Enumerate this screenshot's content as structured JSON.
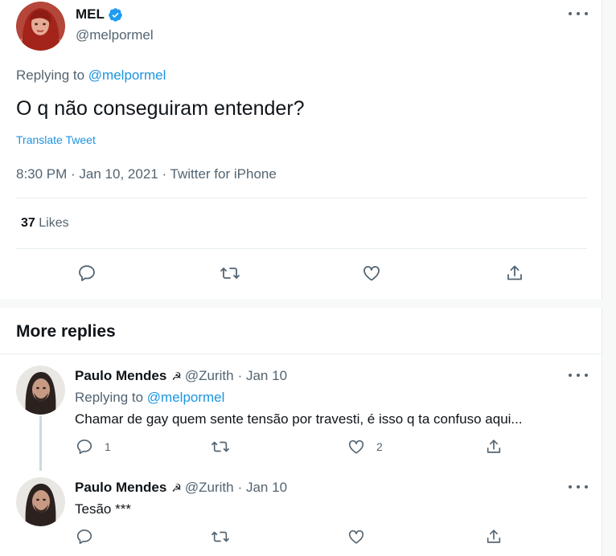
{
  "main_tweet": {
    "display_name": "MEL",
    "handle": "@melpormel",
    "replying_label": "Replying to",
    "replying_handle": "@melpormel",
    "text": "O q não conseguiram entender?",
    "translate_label": "Translate Tweet",
    "meta": "8:30 PM · Jan 10, 2021 · Twitter for iPhone",
    "likes_count": "37",
    "likes_label": "Likes"
  },
  "more_replies": {
    "title": "More replies",
    "replies": [
      {
        "display_name": "Paulo Mendes",
        "symbol": "☭",
        "handle": "@Zurith",
        "date": "· Jan 10",
        "replying_label": "Replying to",
        "replying_handle": "@melpormel",
        "text": "Chamar de gay quem sente tensão por travesti, é isso q ta confuso aqui...",
        "reply_count": "1",
        "like_count": "2"
      },
      {
        "display_name": "Paulo Mendes",
        "symbol": "☭",
        "handle": "@Zurith",
        "date": "· Jan 10",
        "text": "Tesão ***"
      }
    ]
  },
  "icons": [
    "verified-badge-icon",
    "more-icon",
    "reply-icon",
    "retweet-icon",
    "like-icon",
    "share-icon"
  ],
  "colors": {
    "link": "#1b95e0",
    "secondary_text": "#536471",
    "primary_text": "#0f1419",
    "divider": "#e6ecf0"
  }
}
